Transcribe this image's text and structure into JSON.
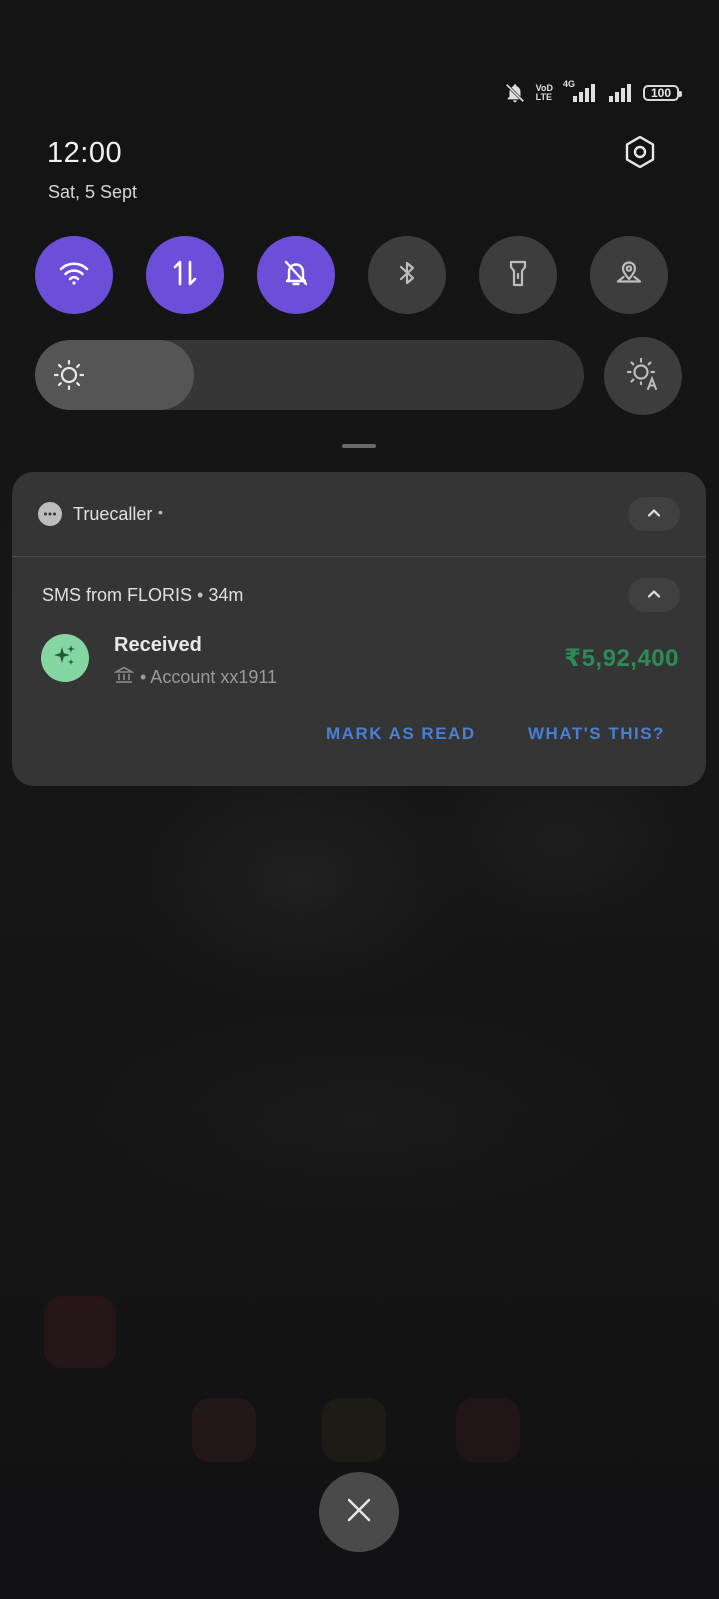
{
  "status_bar": {
    "volte_top": "VoD",
    "volte_bottom": "LTE",
    "network_type": "4G",
    "battery_level": "100"
  },
  "header": {
    "time": "12:00",
    "date": "Sat, 5 Sept"
  },
  "quick_tiles": [
    {
      "name": "wifi",
      "active": true
    },
    {
      "name": "mobile-data",
      "active": true
    },
    {
      "name": "do-not-disturb",
      "active": true
    },
    {
      "name": "bluetooth",
      "active": false
    },
    {
      "name": "flashlight",
      "active": false
    },
    {
      "name": "location",
      "active": false
    }
  ],
  "brightness": {
    "level": 0.29
  },
  "notification": {
    "app_name": "Truecaller",
    "app_dot": "•",
    "sms_sender": "SMS from FLORIS",
    "sms_separator": "•",
    "sms_age": "34m",
    "title": "Received",
    "account_text": "• Account xx1911",
    "amount": "₹5,92,400",
    "actions": {
      "mark_read": "MARK AS READ",
      "whats_this": "WHAT'S THIS?"
    }
  },
  "colors": {
    "active_tile": "#6b4fd8",
    "inactive_tile": "#3d3d3d",
    "amount_green": "#2e8b57",
    "action_blue": "#4a7fd4",
    "avatar_green": "#86d6a3"
  },
  "icons": {
    "status": [
      "dnd-off-icon",
      "signal-icon",
      "battery-icon"
    ],
    "settings": "gear-icon",
    "close": "close-icon"
  }
}
